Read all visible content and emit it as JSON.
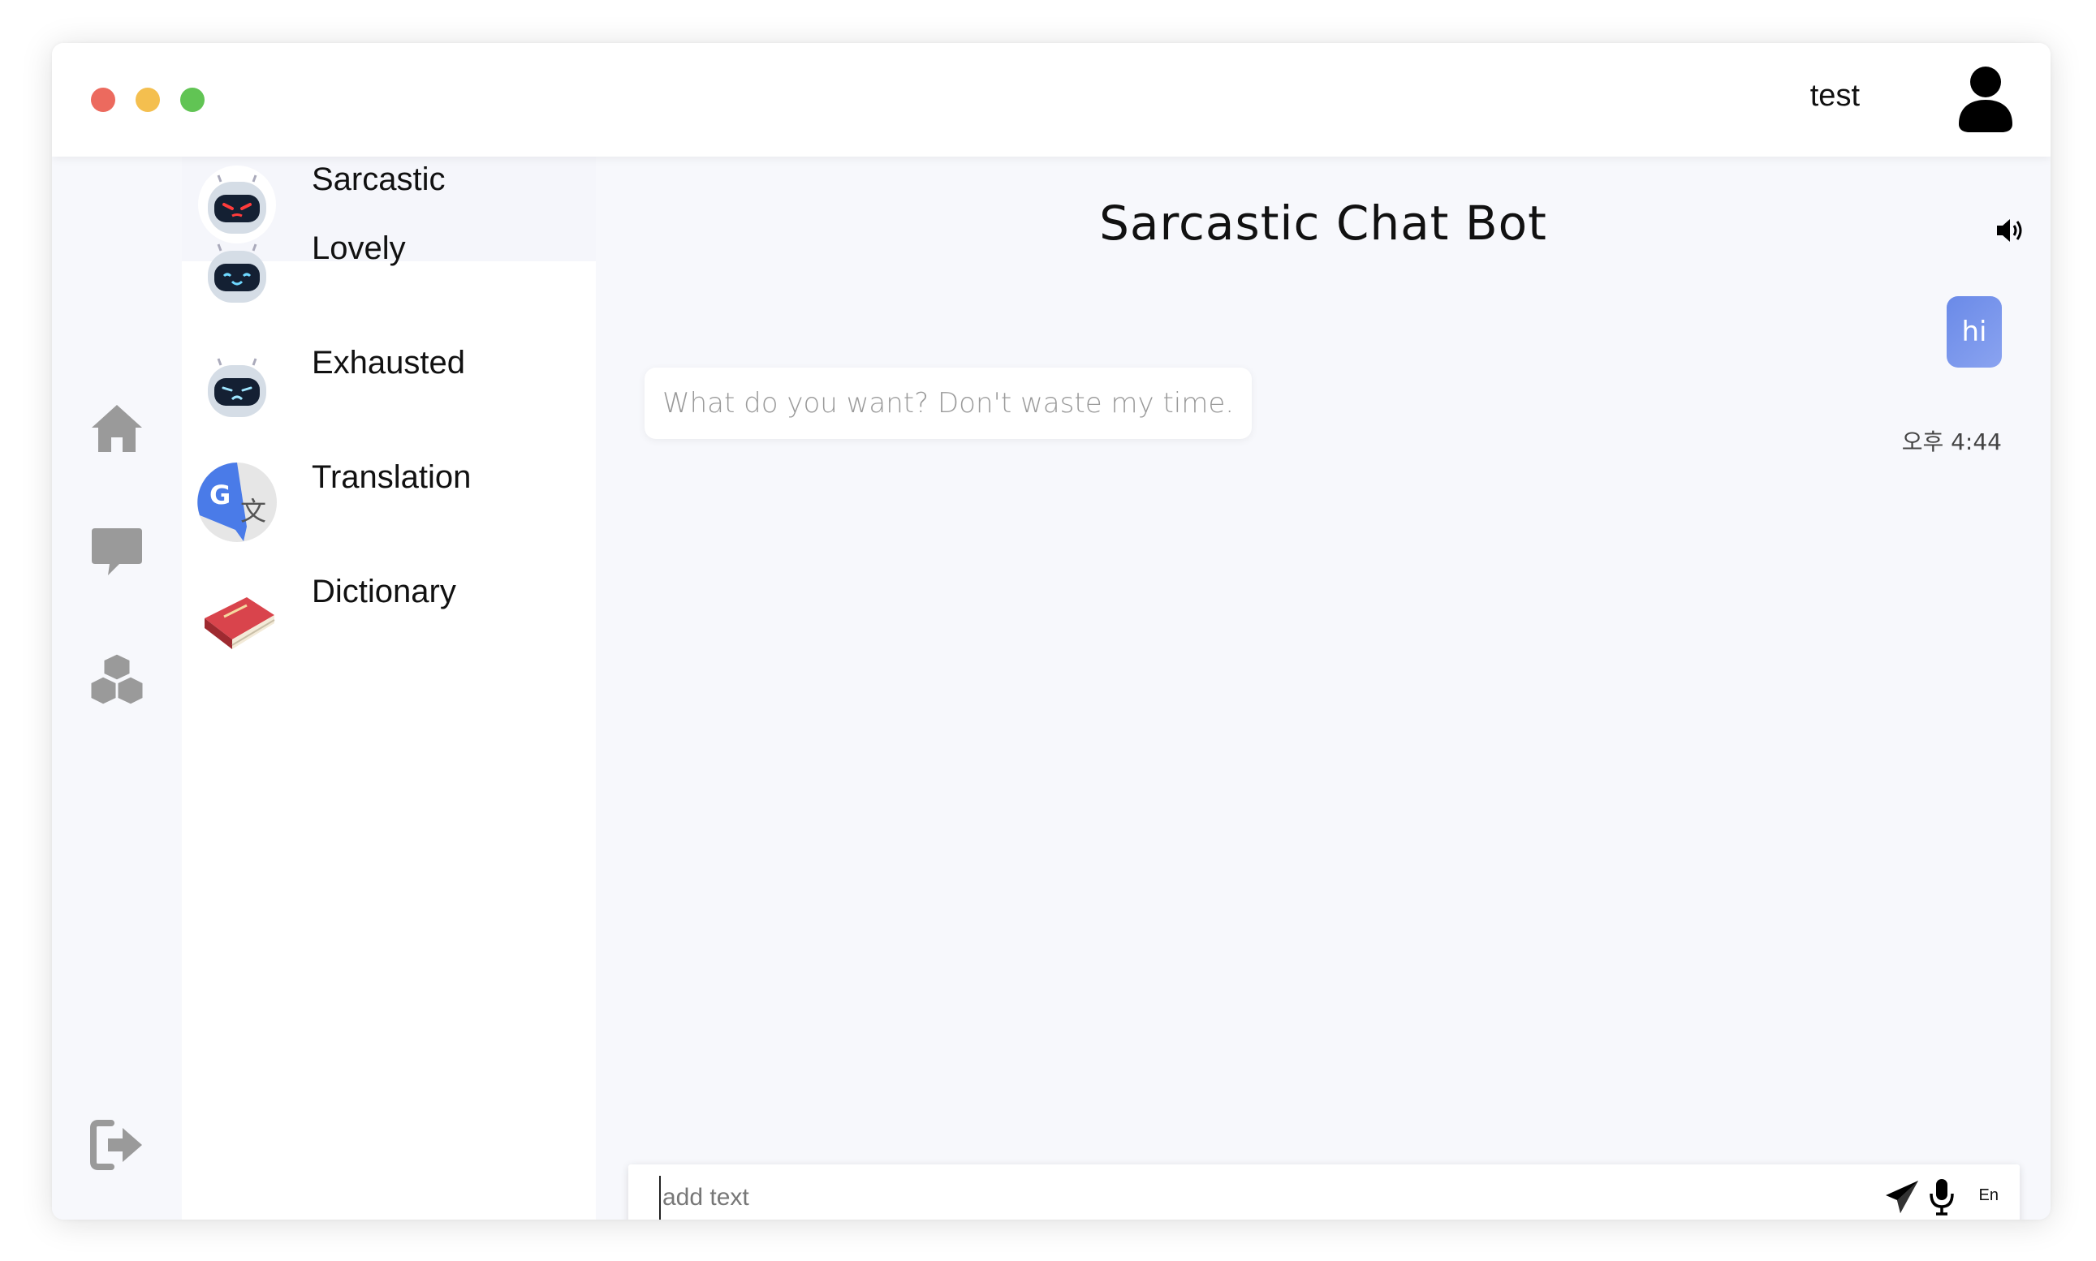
{
  "header": {
    "username": "test"
  },
  "nav": {
    "items": [
      {
        "icon": "home-icon"
      },
      {
        "icon": "chat-icon"
      },
      {
        "icon": "boxes-icon"
      }
    ],
    "logout_icon": "logout-icon"
  },
  "bots": [
    {
      "name": "Sarcastic",
      "icon": "robot-angry-icon",
      "active": true
    },
    {
      "name": "Lovely",
      "icon": "robot-happy-icon"
    },
    {
      "name": "Exhausted",
      "icon": "robot-sad-icon"
    },
    {
      "name": "Translation",
      "icon": "google-translate-icon"
    },
    {
      "name": "Dictionary",
      "icon": "book-icon"
    }
  ],
  "chat": {
    "title": "Sarcastic Chat Bot",
    "messages": [
      {
        "from": "user",
        "text": "hi"
      },
      {
        "from": "bot",
        "text": "What do you want? Don't waste my time."
      }
    ],
    "timestamp": "오후 4:44"
  },
  "input": {
    "placeholder": "add text",
    "value": "",
    "language": "En"
  },
  "colors": {
    "user_bubble": "#7a96ec",
    "background": "#f7f8fc",
    "traffic_red": "#ec6a5e",
    "traffic_yellow": "#f4bf4f",
    "traffic_green": "#61c454"
  }
}
